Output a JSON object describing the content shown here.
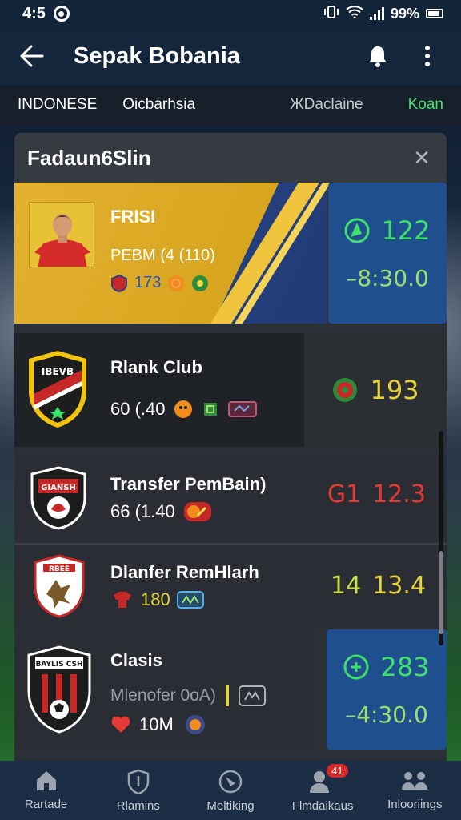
{
  "status": {
    "time": "4:5",
    "battery": "99%"
  },
  "app_bar": {
    "title": "Sepak Bobania"
  },
  "tabs": [
    {
      "label": "INDONESE"
    },
    {
      "label": "Oicbarhsia"
    },
    {
      "label": "ЖDaclaine"
    },
    {
      "label": "Koan"
    }
  ],
  "panel": {
    "title": "Fadaun6Slin",
    "close": "✕"
  },
  "cards": [
    {
      "name": "FRISI",
      "sub": "PEBM (4 (110)",
      "stat": "173",
      "score": "122",
      "score_sub": "–8:30.0"
    },
    {
      "name": "Rlank Club",
      "sub": "60 (.40",
      "score": "193"
    },
    {
      "name": "Transfer PemBain)",
      "sub": "66 (1.40",
      "score_a": "G1",
      "score_b": "12.3"
    },
    {
      "name": "Dlanfer RemHlarh",
      "sub": "180",
      "score_a": "14",
      "score_b": "13.4"
    },
    {
      "name": "Clasis",
      "sub": "Mlenofer 0oA)",
      "stat": "10M",
      "score": "283",
      "score_sub": "–4:30.0"
    }
  ],
  "bottom_nav": [
    {
      "label": "Rartade"
    },
    {
      "label": "Rlamins"
    },
    {
      "label": "Meltiking"
    },
    {
      "label": "Flmdaikaus",
      "badge": "41"
    },
    {
      "label": "Inlooriings"
    }
  ],
  "colors": {
    "accent_green": "#3ee06a",
    "card_gold": "#e3b12f",
    "card_blue": "#1f4f8f",
    "score_red": "#e53935",
    "score_yellow": "#e6d23a"
  }
}
